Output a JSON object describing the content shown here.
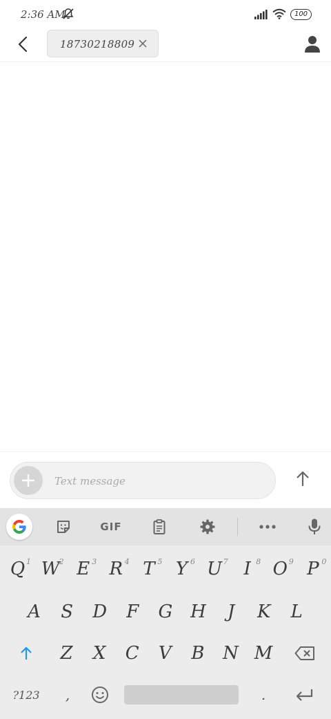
{
  "status_bar": {
    "time": "2:36 AM",
    "battery": "100",
    "icons": [
      "bell-off-icon",
      "signal-icon",
      "wifi-icon",
      "battery-icon"
    ]
  },
  "top_bar": {
    "recipient": "18730218809",
    "icons": [
      "back-arrow-icon",
      "close-icon",
      "contact-icon"
    ]
  },
  "compose": {
    "placeholder": "Text message",
    "value": "",
    "icons": [
      "plus-icon",
      "send-arrow-icon"
    ]
  },
  "keyboard": {
    "toolbar": {
      "gif_label": "GIF",
      "icons": [
        "google-icon",
        "sticker-icon",
        "clipboard-icon",
        "settings-icon",
        "more-icon",
        "microphone-icon"
      ]
    },
    "row1": [
      {
        "key": "Q",
        "hint": "1"
      },
      {
        "key": "W",
        "hint": "2"
      },
      {
        "key": "E",
        "hint": "3"
      },
      {
        "key": "R",
        "hint": "4"
      },
      {
        "key": "T",
        "hint": "5"
      },
      {
        "key": "Y",
        "hint": "6"
      },
      {
        "key": "U",
        "hint": "7"
      },
      {
        "key": "I",
        "hint": "8"
      },
      {
        "key": "O",
        "hint": "9"
      },
      {
        "key": "P",
        "hint": "0"
      }
    ],
    "row2": [
      "A",
      "S",
      "D",
      "F",
      "G",
      "H",
      "J",
      "K",
      "L"
    ],
    "row3": [
      "Z",
      "X",
      "C",
      "V",
      "B",
      "N",
      "M"
    ],
    "symbols_label": "?123",
    "comma": ",",
    "period": ".",
    "accent_color": "#2196f3"
  }
}
